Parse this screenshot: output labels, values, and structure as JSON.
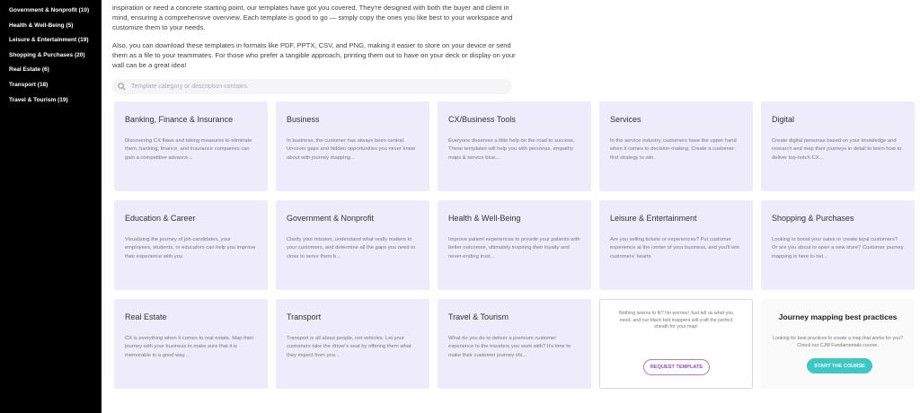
{
  "sidebar": {
    "items": [
      {
        "label": "Government & Nonprofit (10)"
      },
      {
        "label": "Health & Well-Being (5)"
      },
      {
        "label": "Leisure & Entertainment (19)"
      },
      {
        "label": "Shopping & Purchases (20)"
      },
      {
        "label": "Real Estate (6)"
      },
      {
        "label": "Transport (18)"
      },
      {
        "label": "Travel & Tourism (19)"
      }
    ]
  },
  "intro": {
    "paragraph1": "inspiration or need a concrete starting point, our templates have got you covered. They're designed with both the buyer and client in mind, ensuring a comprehensive overview. Each template is good to go — simply copy the ones you like best to your workspace and customize them to your needs.",
    "paragraph2": "Also, you can download these templates in formats like PDF, PPTX, CSV, and PNG, making it easier to store on your device or send them as a file to your teammates. For those who prefer a tangible approach, printing them out to have on your deck or display on your wall can be a great idea!"
  },
  "search": {
    "placeholder": "Template category or description contains"
  },
  "cards": [
    {
      "title": "Banking, Finance & Insurance",
      "desc": "Discovering CX flaws and taking measures to eliminate them, banking, finance, and insurance companies can gain a competitive advance..."
    },
    {
      "title": "Business",
      "desc": "In business, the customer has always been central. Uncover gaps and hidden opportunities you never knew about with journey mapping..."
    },
    {
      "title": "CX/Business Tools",
      "desc": "Everyone deserves a little help on the road to success. These templates will help you with personas, empathy maps & service blue..."
    },
    {
      "title": "Services",
      "desc": "In the service industry, customers have the upper hand when it comes to decision-making. Create a customer-first strategy to win."
    },
    {
      "title": "Digital",
      "desc": "Create digital personas based on your knowledge and research and map their journeys in detail to learn how to deliver top-notch CX..."
    },
    {
      "title": "Education & Career",
      "desc": "Visualizing the journey of job candidates, your employees, students, or educators can help you improve their experience with you"
    },
    {
      "title": "Government & Nonprofit",
      "desc": "Clarify your mission, understand what really matters to your customers, and determine all the gaps you need to close to serve them b..."
    },
    {
      "title": "Health & Well-Being",
      "desc": "Improve patient experiences to provide your patients with better outcomes, ultimately inspiring their loyalty and never-ending trust..."
    },
    {
      "title": "Leisure & Entertainment",
      "desc": "Are you selling tickets or experiences? Put customer experience at the center of your business, and you'll win customers' hearts"
    },
    {
      "title": "Shopping & Purchases",
      "desc": "Looking to boost your sales or create loyal customers? Or are you about to open a new store? Customer journey mapping is here to hel..."
    },
    {
      "title": "Real Estate",
      "desc": "CX is everything when it comes to real estate. Map their journey with your business to make sure that it is memorable in a good way..."
    },
    {
      "title": "Transport",
      "desc": "Transport is all about people, not vehicles. Let your customers take the driver's seat by offering them what they expect from you..."
    },
    {
      "title": "Travel & Tourism",
      "desc": "What do you do to deliver a premium customer experience to the travelers you work with? It's time to make their customer journey shi..."
    }
  ],
  "request_card": {
    "text": "Nothing seems to fit? No worries! Just tell us what you need, and our black belt mappers will craft the perfect sheath for your map!",
    "button": "REQUEST TEMPLATE"
  },
  "practices_card": {
    "title": "Journey mapping best practices",
    "text": "Looking for best practices to create a map that works for you? Check our CJM Fundamentals course.",
    "button": "START THE COURSE"
  }
}
